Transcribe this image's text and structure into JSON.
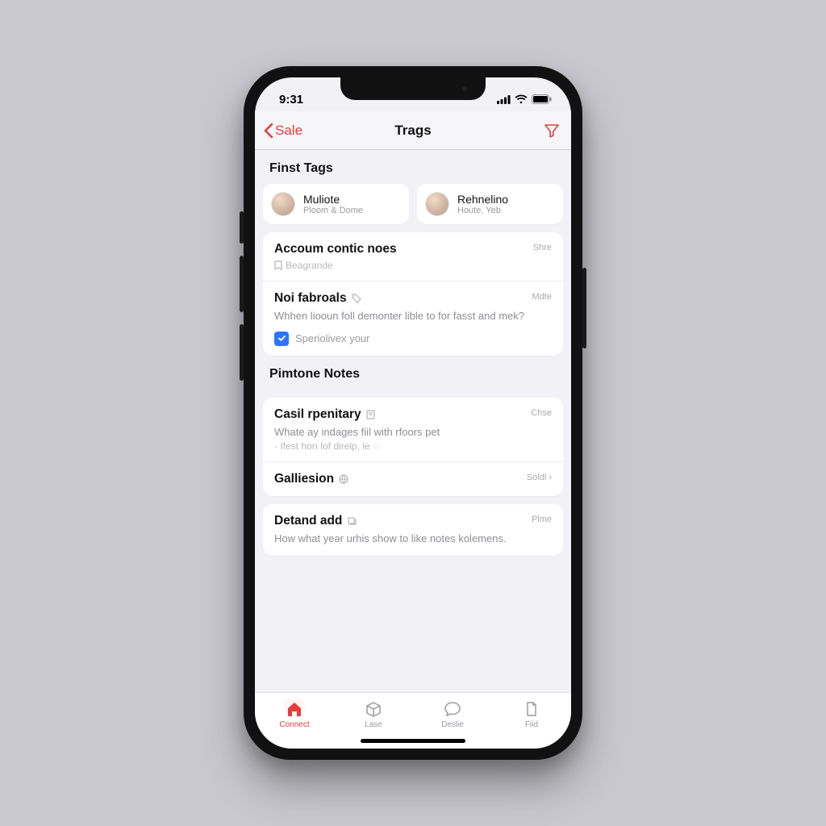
{
  "status": {
    "time": "9:31"
  },
  "nav": {
    "back_label": "Sale",
    "title": "Trags"
  },
  "first_tags": {
    "header": "Finst Tags",
    "items": [
      {
        "name": "Muliote",
        "sub": "Ploom & Dome"
      },
      {
        "name": "Rehnelino",
        "sub": "Houte, Yeb"
      }
    ]
  },
  "account": {
    "header": "Accoum contic noes",
    "action": "Shre",
    "cells": [
      {
        "title": "Beagrande"
      },
      {
        "title": "Noi fabroals",
        "action": "Mdte",
        "body": "Whhen liooun foll demonter lible to for fasst and mek?",
        "check_label": "Speriolivex your"
      }
    ]
  },
  "pimtone": {
    "header": "Pimtone Notes",
    "cells": [
      {
        "title": "Casil rpenitary",
        "action": "Chse",
        "body": "Whate ay indages fiil with rfoors pet",
        "sub": "- Ifest horı lof direlp, le"
      },
      {
        "title": "Galliesion",
        "action": "Soldl ›"
      },
      {
        "title": "Detand add",
        "action": "Plme",
        "body": "How what yeәr urhis show to like notes kolemens."
      }
    ]
  },
  "tabs": [
    {
      "label": "Connect"
    },
    {
      "label": "Lase"
    },
    {
      "label": "Deslie"
    },
    {
      "label": "Fiid"
    }
  ],
  "colors": {
    "accent": "#e83c3c",
    "blue": "#2f74ff"
  }
}
